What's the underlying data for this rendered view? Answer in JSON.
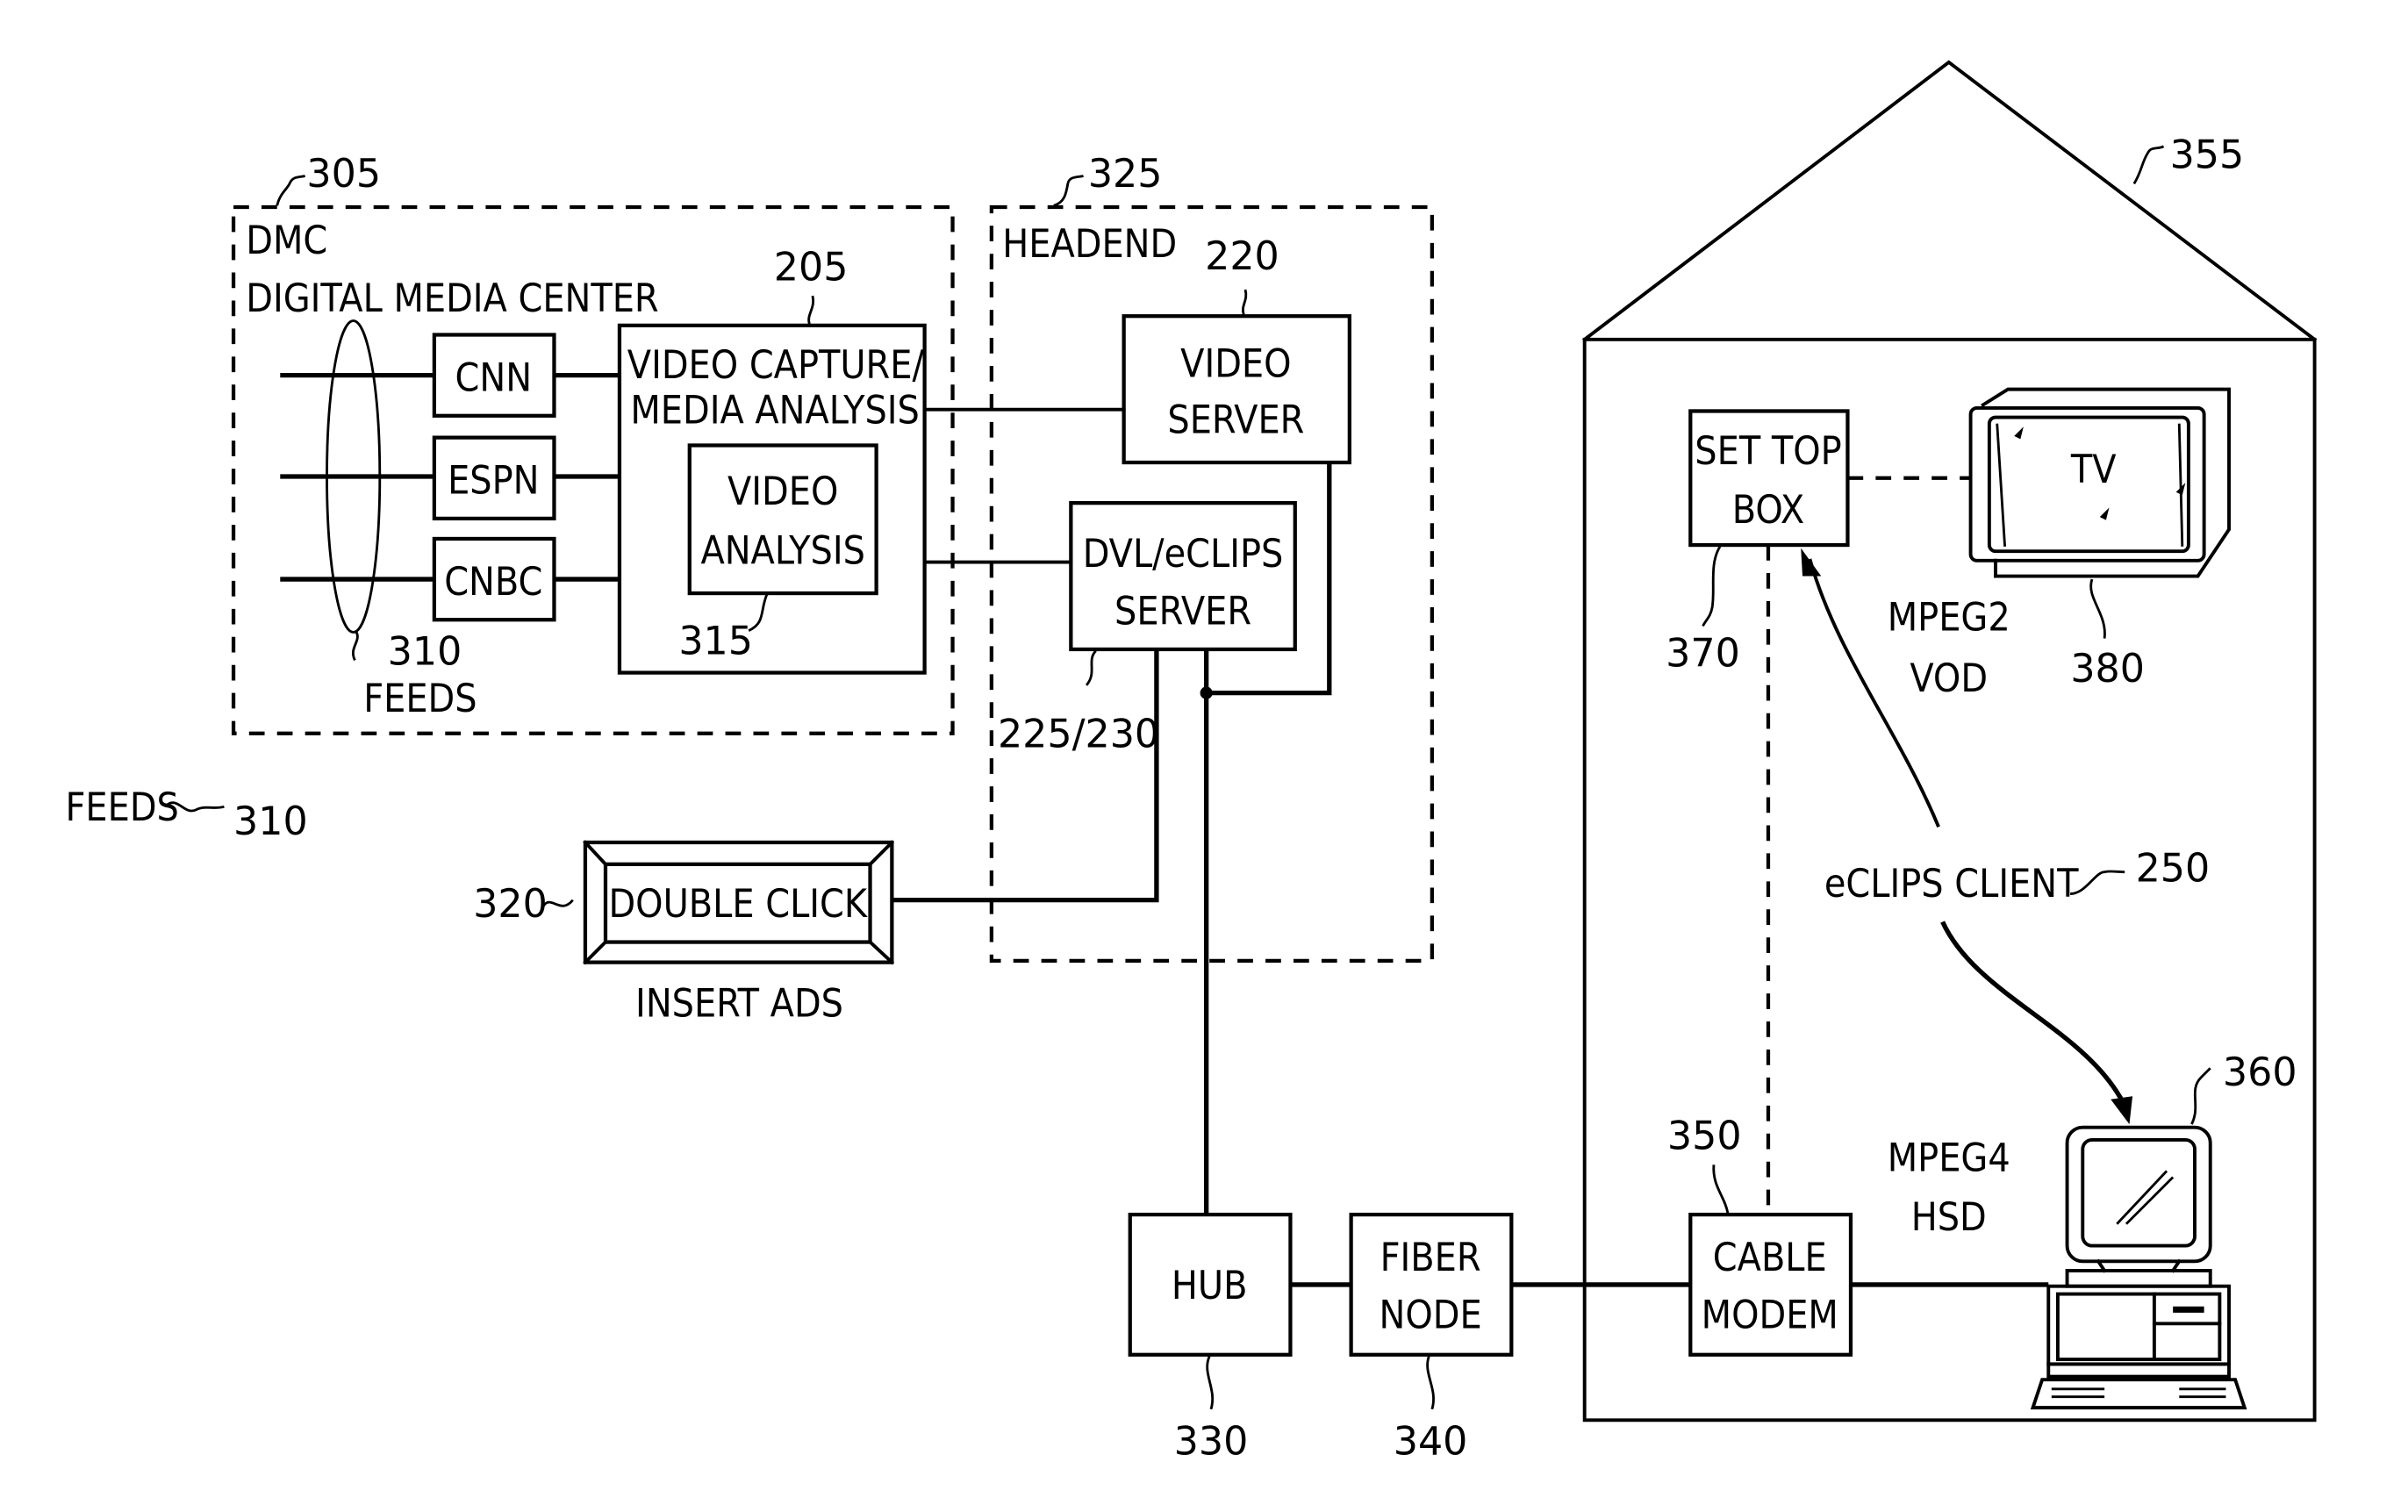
{
  "diagram": {
    "dmc": {
      "ref": "305",
      "title_short": "DMC",
      "title_long": "DIGITAL MEDIA CENTER",
      "feeds": [
        "CNN",
        "ESPN",
        "CNBC"
      ],
      "feeds_ref": "310",
      "feeds_label": "FEEDS",
      "capture_box": {
        "ref": "205",
        "line1": "VIDEO CAPTURE/",
        "line2": "MEDIA ANALYSIS"
      },
      "analysis_box": {
        "ref": "315",
        "line1": "VIDEO",
        "line2": "ANALYSIS"
      }
    },
    "headend": {
      "ref": "325",
      "title": "HEADEND",
      "video_server": {
        "ref": "220",
        "line1": "VIDEO",
        "line2": "SERVER"
      },
      "dvl_server": {
        "ref": "225/230",
        "line1": "DVL/eCLIPS",
        "line2": "SERVER"
      }
    },
    "feeds_legend": {
      "label": "FEEDS",
      "ref": "310"
    },
    "doubleclick": {
      "ref": "320",
      "label": "DOUBLE CLICK",
      "caption": "INSERT ADS"
    },
    "hub": {
      "ref": "330",
      "label": "HUB"
    },
    "fiber_node": {
      "ref": "340",
      "line1": "FIBER",
      "line2": "NODE"
    },
    "home": {
      "ref": "355",
      "set_top_box": {
        "ref": "370",
        "line1": "SET TOP",
        "line2": "BOX"
      },
      "tv": {
        "ref": "380",
        "label": "TV"
      },
      "mpeg2": {
        "line1": "MPEG2",
        "line2": "VOD"
      },
      "eclips_client": {
        "label": "eCLIPS CLIENT",
        "ref": "250"
      },
      "cable_modem": {
        "ref": "350",
        "line1": "CABLE",
        "line2": "MODEM"
      },
      "mpeg4": {
        "line1": "MPEG4",
        "line2": "HSD"
      },
      "computer": {
        "ref": "360"
      }
    }
  }
}
